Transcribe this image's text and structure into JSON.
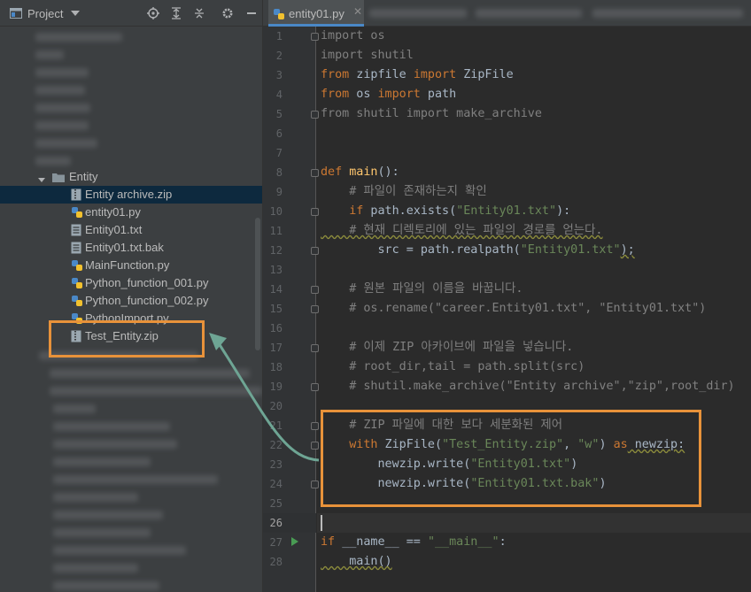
{
  "project_panel": {
    "title": "Project",
    "tree": [
      {
        "label": "Entity",
        "type": "folder",
        "expanded": true
      },
      {
        "label": "Entity archive.zip",
        "type": "zip",
        "selected": true
      },
      {
        "label": "entity01.py",
        "type": "python"
      },
      {
        "label": "Entity01.txt",
        "type": "text"
      },
      {
        "label": "Entity01.txt.bak",
        "type": "text"
      },
      {
        "label": "MainFunction.py",
        "type": "python"
      },
      {
        "label": "Python_function_001.py",
        "type": "python"
      },
      {
        "label": "Python_function_002.py",
        "type": "python"
      },
      {
        "label": "PythonImport.py",
        "type": "python"
      },
      {
        "label": "Test_Entity.zip",
        "type": "zip"
      }
    ]
  },
  "editor": {
    "tab_label": "entity01.py",
    "current_line": 26,
    "line_numbers": [
      "1",
      "2",
      "3",
      "4",
      "5",
      "6",
      "7",
      "8",
      "9",
      "10",
      "11",
      "12",
      "13",
      "14",
      "15",
      "16",
      "17",
      "18",
      "19",
      "20",
      "21",
      "22",
      "23",
      "24",
      "25",
      "26",
      "27",
      "28"
    ],
    "code": {
      "l1": "import os",
      "l2": "import shutil",
      "l3_a": "from",
      "l3_b": " zipfile ",
      "l3_c": "import",
      "l3_d": " ZipFile",
      "l4_a": "from",
      "l4_b": " os ",
      "l4_c": "import",
      "l4_d": " path",
      "l5": "from shutil import make_archive",
      "l8_a": "def",
      "l8_b": " ",
      "l8_c": "main",
      "l8_d": "():",
      "l9": "    # 파일이 존재하는지 확인",
      "l10_a": "    ",
      "l10_b": "if",
      "l10_c": " path.exists(",
      "l10_d": "\"Entity01.txt\"",
      "l10_e": "):",
      "l11": "    # 현재 디렉토리에 있는 파일의 경로를 얻는다.",
      "l12_a": "        src = path.realpath(",
      "l12_b": "\"Entity01.txt\"",
      "l12_c": ");",
      "l14": "    # 원본 파일의 이름을 바꿉니다.",
      "l15": "    # os.rename(\"career.Entity01.txt\", \"Entity01.txt\")",
      "l17": "    # 이제 ZIP 아카이브에 파일을 넣습니다.",
      "l18": "    # root_dir,tail = path.split(src)",
      "l19": "    # shutil.make_archive(\"Entity archive\",\"zip\",root_dir)",
      "l21": "    # ZIP 파일에 대한 보다 세분화된 제어",
      "l22_a": "    ",
      "l22_b": "with",
      "l22_c": " ZipFile(",
      "l22_d": "\"Test_Entity.zip\"",
      "l22_e": ", ",
      "l22_f": "\"w\"",
      "l22_g": ") ",
      "l22_h": "as",
      "l22_i": " newzip:",
      "l23_a": "        newzip.write(",
      "l23_b": "\"Entity01.txt\"",
      "l23_c": ")",
      "l24_a": "        newzip.write(",
      "l24_b": "\"Entity01.txt.bak\"",
      "l24_c": ")",
      "l27_a": "if",
      "l27_b": " ",
      "l27_c": "__name__",
      "l27_d": " == ",
      "l27_e": "\"__main__\"",
      "l27_f": ":",
      "l28": "    main()"
    }
  },
  "colors": {
    "keyword": "#cc7832",
    "string": "#6a8759",
    "comment": "#808080",
    "function": "#ffc66d",
    "highlight": "#e8923a",
    "arrow": "#6ea594"
  },
  "icons": [
    "project-window-icon",
    "dropdown-icon",
    "locate-icon",
    "expand-all-icon",
    "collapse-all-icon",
    "gear-icon",
    "minimize-icon",
    "folder-icon",
    "zip-file-icon",
    "python-file-icon",
    "text-file-icon",
    "run-icon",
    "fold-icon"
  ]
}
